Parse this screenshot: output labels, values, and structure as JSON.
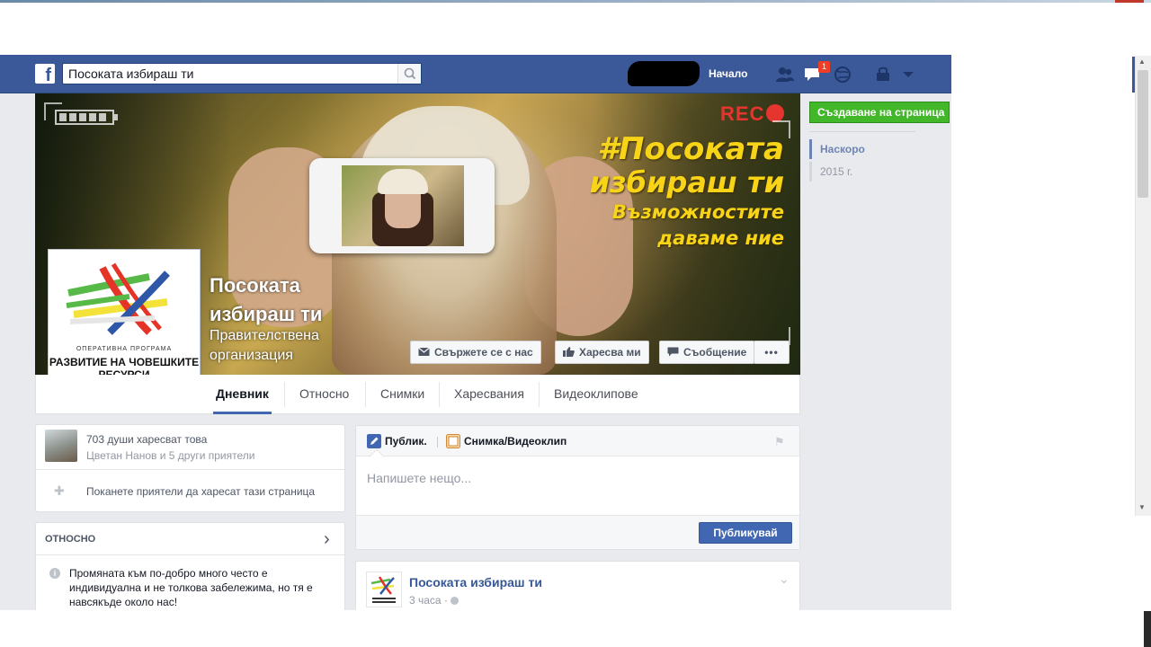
{
  "header": {
    "search_value": "Посоката избираш ти",
    "home_label": "Начало",
    "notification_count": "1"
  },
  "cover": {
    "slogan_line1": "#Посоката",
    "slogan_line2": "избираш ти",
    "slogan_line3": "Възможностите",
    "slogan_line4": "даваме ние",
    "rec_label": "REC",
    "page_name": "Посоката избираш ти",
    "page_category": "Правителствена организация",
    "buttons": {
      "contact": "Свържете се с нас",
      "like": "Харесва ми",
      "message": "Съобщение",
      "more": "•••"
    },
    "profile_caption_small": "ОПЕРАТИВНА ПРОГРАМА",
    "profile_caption_big": "РАЗВИТИЕ НА ЧОВЕШКИТЕ РЕСУРСИ"
  },
  "tabs": [
    {
      "label": "Дневник"
    },
    {
      "label": "Относно"
    },
    {
      "label": "Снимки"
    },
    {
      "label": "Харесвания"
    },
    {
      "label": "Видеоклипове"
    }
  ],
  "right_rail": {
    "create_page": "Създаване на страница",
    "timeline_now": "Наскоро",
    "timeline_year": "2015 г."
  },
  "likes_card": {
    "count_text": "703 души харесват това",
    "friends_text": "Цветан Нанов и 5 други приятели",
    "invite_text": "Поканете приятели да харесат тази страница"
  },
  "about_card": {
    "heading": "ОТНОСНО",
    "text": "Промяната към по-добро много често е индивидуална и не толкова забележима, но тя е навсякъде около нас!"
  },
  "composer": {
    "tab_post": "Публик.",
    "tab_photo": "Снимка/Видеоклип",
    "placeholder": "Напишете нещо...",
    "publish": "Публикувай"
  },
  "post": {
    "author": "Посоката избираш ти",
    "time": "3 часа ·"
  },
  "colors": {
    "facebook_blue": "#3b5998",
    "green_button": "#42b72a",
    "slogan_yellow": "#f7d417",
    "rec_red": "#e5352e"
  }
}
